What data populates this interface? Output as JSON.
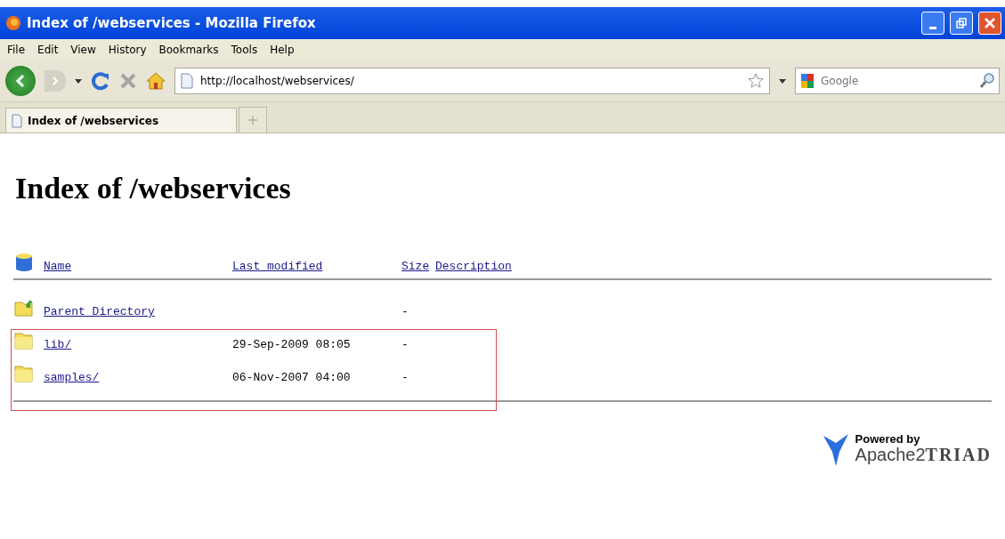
{
  "window": {
    "title": "Index of /webservices - Mozilla Firefox"
  },
  "menu": [
    "File",
    "Edit",
    "View",
    "History",
    "Bookmarks",
    "Tools",
    "Help"
  ],
  "address": {
    "value": "http://localhost/webservices/"
  },
  "search": {
    "placeholder": "Google"
  },
  "tabs": [
    {
      "label": "Index of /webservices",
      "selected": true
    }
  ],
  "page": {
    "heading": "Index of /webservices",
    "columns": [
      "Name",
      "Last modified",
      "Size",
      "Description"
    ],
    "rows": [
      {
        "kind": "parent",
        "name": "Parent Directory",
        "modified": "",
        "size": "-"
      },
      {
        "kind": "folder",
        "name": "lib/",
        "modified": "29-Sep-2009 08:05",
        "size": "-"
      },
      {
        "kind": "folder",
        "name": "samples/",
        "modified": "06-Nov-2007 04:00",
        "size": "-"
      }
    ],
    "footer": {
      "caption": "Powered by",
      "brand": "Apache2",
      "brand_suffix": "TRIAD"
    }
  }
}
